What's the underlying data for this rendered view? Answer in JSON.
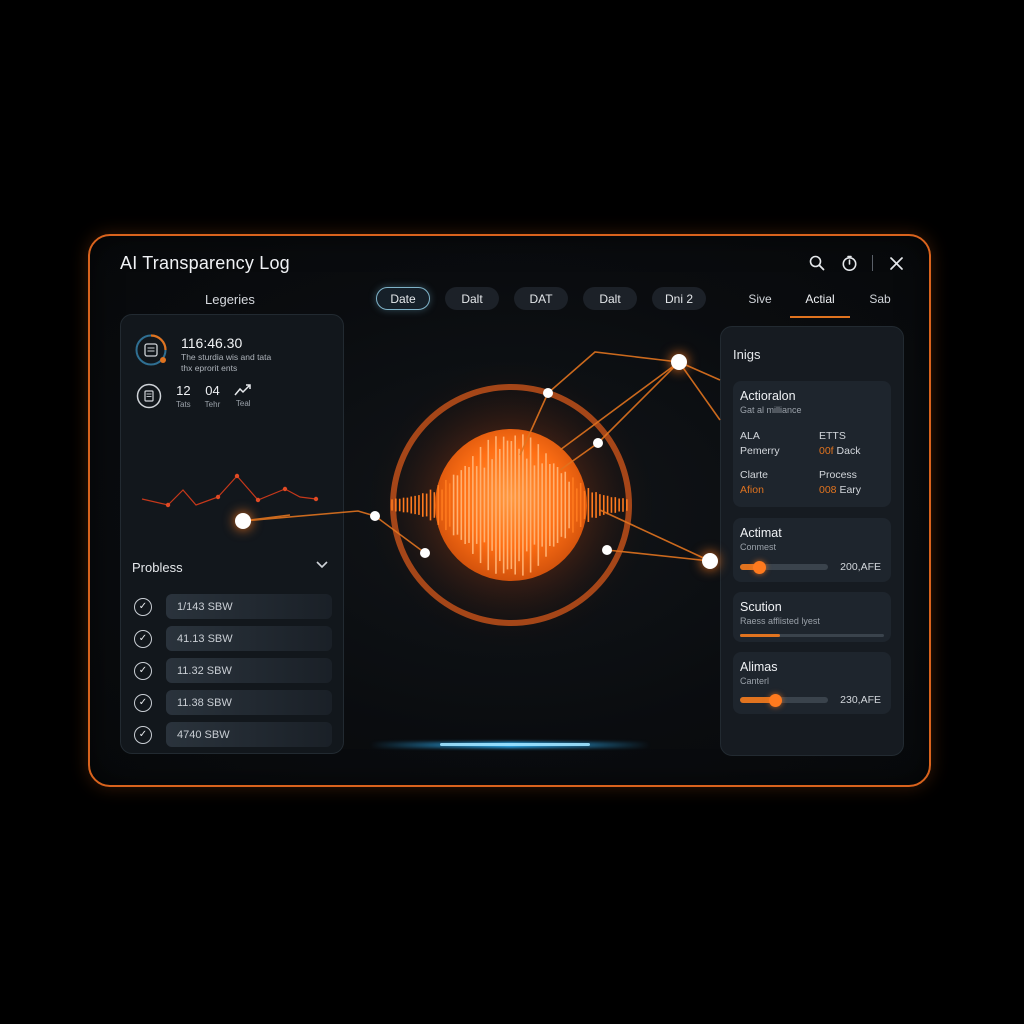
{
  "window": {
    "title": "AI Transparency Log"
  },
  "sidebar": {
    "label": "Legeries",
    "stat": {
      "time": "116:46.30",
      "desc_line1": "The sturdia wis and tata",
      "desc_line2": "thx eprorit ents"
    },
    "mini": [
      {
        "num": "12",
        "label": "Tats"
      },
      {
        "num": "04",
        "label": "Tehr"
      },
      {
        "num": "",
        "label": "Teal"
      }
    ],
    "problems": {
      "title": "Probless",
      "items": [
        {
          "label": "1/143 SBW"
        },
        {
          "label": "41.13 SBW"
        },
        {
          "label": "11.32 SBW"
        },
        {
          "label": "11.38 SBW"
        },
        {
          "label": "4740 SBW"
        }
      ]
    }
  },
  "tabs": [
    {
      "label": "Date",
      "active": true
    },
    {
      "label": "Dalt"
    },
    {
      "label": "DAT"
    },
    {
      "label": "Dalt"
    },
    {
      "label": "Dni 2"
    }
  ],
  "plain_tabs": [
    {
      "label": "Sive"
    },
    {
      "label": "Actial",
      "active": true
    },
    {
      "label": "Sab"
    }
  ],
  "right_panel": {
    "title": "Inigs",
    "card1": {
      "title": "Actioralon",
      "subtitle": "Gat al milliance",
      "cells": [
        {
          "top": "ALA",
          "bottom": "Pemerry",
          "highlight": false
        },
        {
          "top": "ETTS",
          "bottom_hi": "00f",
          "bottom": " Dack"
        },
        {
          "top": "Clarte",
          "bottom": "Afion",
          "highlight": true
        },
        {
          "top": "Process",
          "bottom_hi": "008",
          "bottom": " Eary"
        }
      ]
    },
    "card2": {
      "title": "Actimat",
      "subtitle": "Conmest",
      "value": "200,AFE",
      "level": 0.22
    },
    "card3": {
      "title": "Scution",
      "subtitle": "Raess afflisted lyest",
      "level": 0.28
    },
    "card4": {
      "title": "Alimas",
      "subtitle": "Canterl",
      "value": "230,AFE",
      "level": 0.4
    }
  },
  "colors": {
    "accent": "#e0731f",
    "frame": "#d9631d",
    "glow_blue": "#2fb8ff",
    "panel": "#12171c"
  },
  "icons": [
    "search-icon",
    "timer-icon",
    "close-icon",
    "gauge-icon",
    "document-icon",
    "trend-icon",
    "chevron-down-icon",
    "check-icon"
  ]
}
